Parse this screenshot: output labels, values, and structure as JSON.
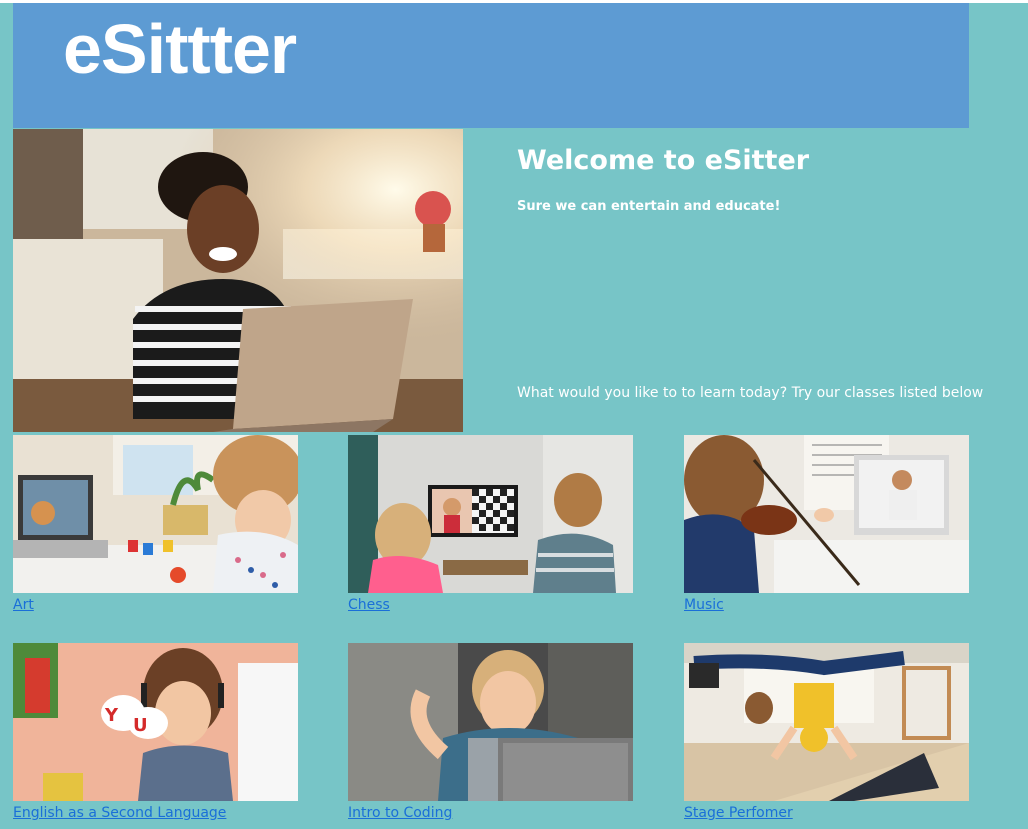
{
  "header": {
    "logo": "eSittter"
  },
  "hero": {
    "title": "Welcome to eSitter",
    "subtitle": "Sure we can entertain and educate!",
    "prompt": "What would you like to to learn today? Try our classes listed below"
  },
  "classes": [
    {
      "label": "Art"
    },
    {
      "label": "Chess"
    },
    {
      "label": "Music"
    },
    {
      "label": "English as a Second Language"
    },
    {
      "label": "Intro to Coding"
    },
    {
      "label": "Stage Perfomer"
    }
  ],
  "colors": {
    "page_bg": "#77c5c7",
    "header_bg": "#5d9bd3",
    "link": "#1a6fd8",
    "text": "#ffffff"
  }
}
